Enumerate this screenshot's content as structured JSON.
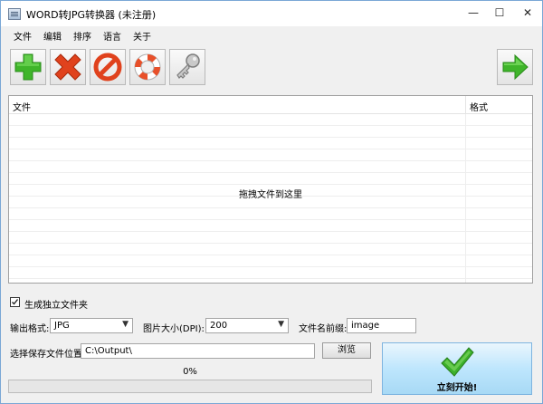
{
  "window": {
    "title": "WORD转JPG转换器 (未注册)",
    "controls": {
      "minimize": "—",
      "maximize": "☐",
      "close": "✕"
    }
  },
  "menu": [
    "文件",
    "编辑",
    "排序",
    "语言",
    "关于"
  ],
  "toolbar": {
    "buttons": [
      {
        "icon": "add-icon",
        "color": "#3fb52a"
      },
      {
        "icon": "delete-icon",
        "color": "#e0421d"
      },
      {
        "icon": "clear-icon",
        "color": "#e0421d"
      },
      {
        "icon": "help-lifebuoy-icon",
        "color": "#e8502a"
      },
      {
        "icon": "key-icon",
        "color": "#9a9a9a"
      },
      {
        "icon": "next-arrow-icon",
        "color": "#3fb52a"
      }
    ]
  },
  "file_list": {
    "columns": [
      "文件",
      "格式"
    ],
    "rows": [],
    "drop_hint": "拖拽文件到这里"
  },
  "options": {
    "separate_folder_label": "生成独立文件夹",
    "separate_folder_checked": true,
    "output_format_label": "输出格式:",
    "output_format_value": "JPG",
    "dpi_label": "图片大小(DPI):",
    "dpi_value": "200",
    "prefix_label": "文件名前缀:",
    "prefix_value": "image"
  },
  "save": {
    "label": "选择保存文件位置",
    "path": "C:\\Output\\",
    "browse_label": "浏览"
  },
  "progress": {
    "text": "0%",
    "value": 0
  },
  "start": {
    "label": "立刻开始!",
    "color": "#3bb02a"
  }
}
